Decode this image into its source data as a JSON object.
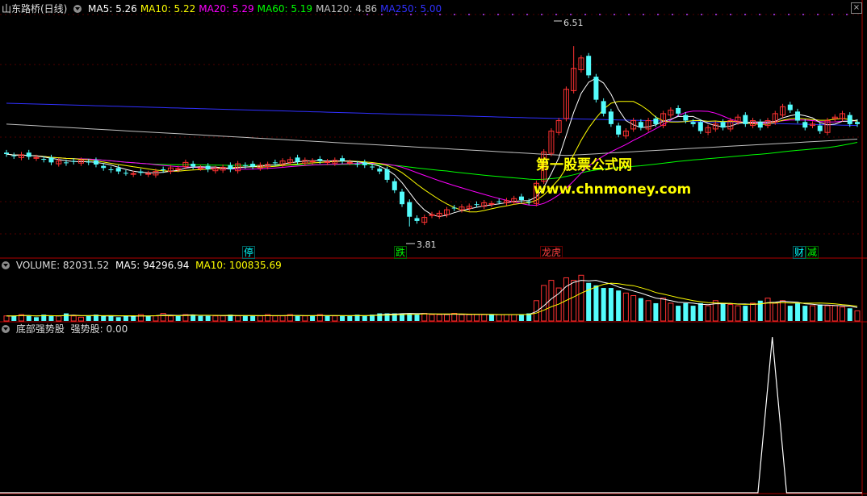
{
  "header": {
    "stock_name": "山东路桥(日线)",
    "ma": [
      {
        "label": "MA5: 5.26",
        "color": "#ffffff"
      },
      {
        "label": "MA10: 5.22",
        "color": "#ffff00"
      },
      {
        "label": "MA20: 5.29",
        "color": "#ff00ff"
      },
      {
        "label": "MA60: 5.19",
        "color": "#00ff00"
      },
      {
        "label": "MA120: 4.86",
        "color": "#c0c0c0"
      },
      {
        "label": "MA250: 5.00",
        "color": "#3030ff"
      }
    ],
    "close_glyph": "×"
  },
  "volume_header": {
    "title": "VOLUME: 82031.52",
    "ma5": "MA5: 94296.94",
    "ma10": "MA10: 100835.69"
  },
  "indicator_header": {
    "name": "底部强势股",
    "value": "强势股: 0.00"
  },
  "annotations": {
    "high": "6.51",
    "low": "3.81",
    "events": [
      {
        "text": "停",
        "color": "#00ffff"
      },
      {
        "text": "跌",
        "color": "#00ff00"
      },
      {
        "text": "龙虎",
        "color": "#ff4040"
      },
      {
        "text": "财",
        "color": "#00ffff"
      },
      {
        "text": "减",
        "color": "#00ff00"
      }
    ]
  },
  "watermark": {
    "line1": "第一股票公式网",
    "line2": "www.chnmoney.com"
  },
  "colors": {
    "up": "#ff3232",
    "down": "#54fcfc",
    "border": "#b00000",
    "ma5": "#ffffff",
    "ma10": "#ffff00",
    "ma20": "#ff00ff",
    "ma60": "#00ff00",
    "ma120": "#c0c0c0",
    "ma250": "#3030ff",
    "indicator": "#ffffff"
  },
  "chart_data": [
    {
      "type": "candlestick",
      "title": "山东路桥(日线)",
      "ylim": [
        3.5,
        6.8
      ],
      "series_close": [
        4.82,
        4.79,
        4.81,
        4.78,
        4.77,
        4.74,
        4.7,
        4.72,
        4.69,
        4.71,
        4.73,
        4.7,
        4.67,
        4.62,
        4.59,
        4.57,
        4.55,
        4.54,
        4.55,
        4.54,
        4.57,
        4.59,
        4.62,
        4.61,
        4.7,
        4.64,
        4.62,
        4.6,
        4.61,
        4.63,
        4.6,
        4.68,
        4.65,
        4.64,
        4.66,
        4.67,
        4.69,
        4.72,
        4.74,
        4.71,
        4.73,
        4.72,
        4.72,
        4.71,
        4.73,
        4.72,
        4.7,
        4.67,
        4.66,
        4.63,
        4.57,
        4.45,
        4.3,
        4.1,
        3.92,
        3.86,
        3.91,
        3.95,
        3.97,
        4.02,
        4.04,
        4.06,
        4.07,
        4.09,
        4.12,
        4.11,
        4.14,
        4.15,
        4.18,
        4.16,
        4.13,
        4.4,
        4.85,
        5.15,
        5.3,
        5.75,
        6.05,
        6.2,
        5.95,
        5.6,
        5.4,
        5.25,
        5.1,
        5.15,
        5.3,
        5.2,
        5.3,
        5.25,
        5.4,
        5.45,
        5.4,
        5.3,
        5.25,
        5.15,
        5.2,
        5.25,
        5.2,
        5.3,
        5.35,
        5.25,
        5.3,
        5.2,
        5.3,
        5.4,
        5.5,
        5.45,
        5.3,
        5.2,
        5.25,
        5.15,
        5.3,
        5.35,
        5.4,
        5.25,
        5.25
      ]
    },
    {
      "type": "bar",
      "title": "VOLUME",
      "values": [
        4,
        4,
        5,
        4,
        3,
        5,
        4,
        4,
        6,
        4,
        3,
        4,
        5,
        4,
        4,
        3,
        4,
        4,
        5,
        4,
        4,
        6,
        4,
        4,
        5,
        5,
        4,
        4,
        4,
        4,
        5,
        4,
        4,
        4,
        4,
        5,
        4,
        4,
        5,
        4,
        4,
        4,
        5,
        4,
        4,
        4,
        4,
        5,
        4,
        5,
        6,
        6,
        6,
        6,
        6,
        5,
        6,
        5,
        5,
        5,
        6,
        5,
        5,
        5,
        5,
        5,
        5,
        5,
        5,
        5,
        6,
        16,
        28,
        32,
        26,
        34,
        32,
        36,
        30,
        28,
        26,
        26,
        24,
        22,
        20,
        18,
        16,
        14,
        18,
        14,
        12,
        14,
        12,
        14,
        12,
        16,
        14,
        13,
        12,
        12,
        14,
        16,
        18,
        14,
        16,
        12,
        14,
        12,
        12,
        13,
        12,
        12,
        11,
        10,
        8
      ]
    },
    {
      "type": "line",
      "title": "底部强势股",
      "series": [
        {
          "name": "强势股",
          "values": [
            0,
            0,
            0,
            0,
            0,
            0,
            1,
            0,
            0,
            0
          ]
        }
      ],
      "ylim": [
        0,
        1
      ]
    }
  ]
}
